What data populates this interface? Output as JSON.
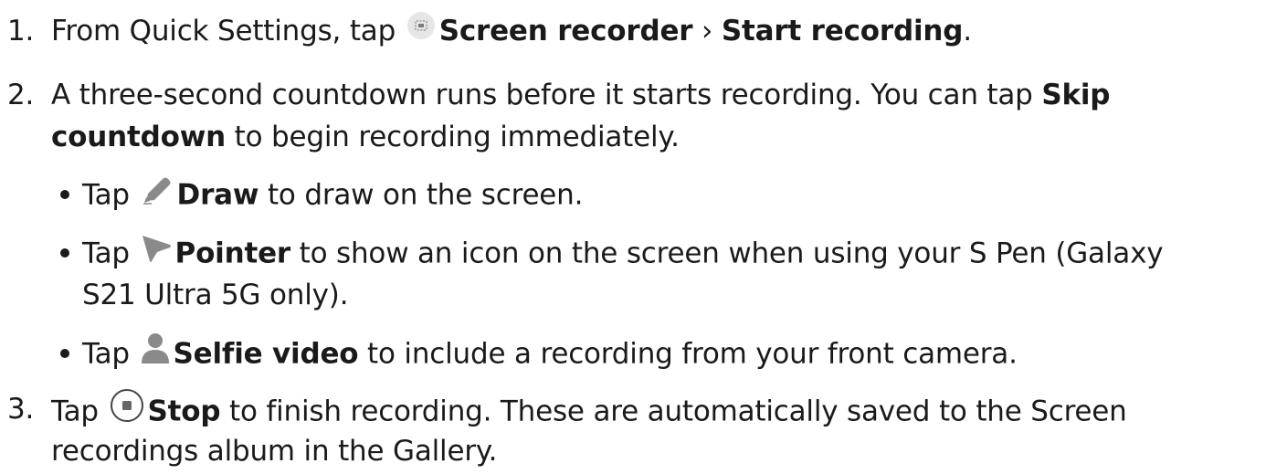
{
  "steps": [
    {
      "number": "1.",
      "lines": [
        {
          "pre": "From Quick Settings, tap ",
          "icon": "screen-recorder-icon",
          "bold1": "Screen recorder",
          "sep": " › ",
          "bold2": "Start recording",
          "post": "."
        }
      ]
    },
    {
      "number": "2.",
      "line1_pre": "A three-second countdown runs before it starts recording. You can tap ",
      "line1_bold": "Skip",
      "line2_bold": "countdown",
      "line2_post": " to begin recording immediately."
    },
    {
      "number": "3.",
      "line1_pre": "Tap ",
      "icon": "stop-icon",
      "line1_bold": "Stop",
      "line1_post": " to finish recording. These are automatically saved to the Screen",
      "line2": "recordings album in the Gallery."
    }
  ],
  "bullets": [
    {
      "pre": "Tap ",
      "icon": "draw-icon",
      "bold": "Draw",
      "post": " to draw on the screen."
    },
    {
      "pre": "Tap ",
      "icon": "pointer-icon",
      "bold": "Pointer",
      "post": " to show an icon on the screen when using your S Pen (Galaxy",
      "line2": "S21 Ultra 5G only)."
    },
    {
      "pre": "Tap ",
      "icon": "selfie-video-icon",
      "bold": "Selfie video",
      "post": " to include a recording from your front camera."
    }
  ],
  "colors": {
    "text": "#1a1a1a",
    "icon_gray": "#8a8a8a",
    "icon_bg": "#e4e4e4"
  }
}
